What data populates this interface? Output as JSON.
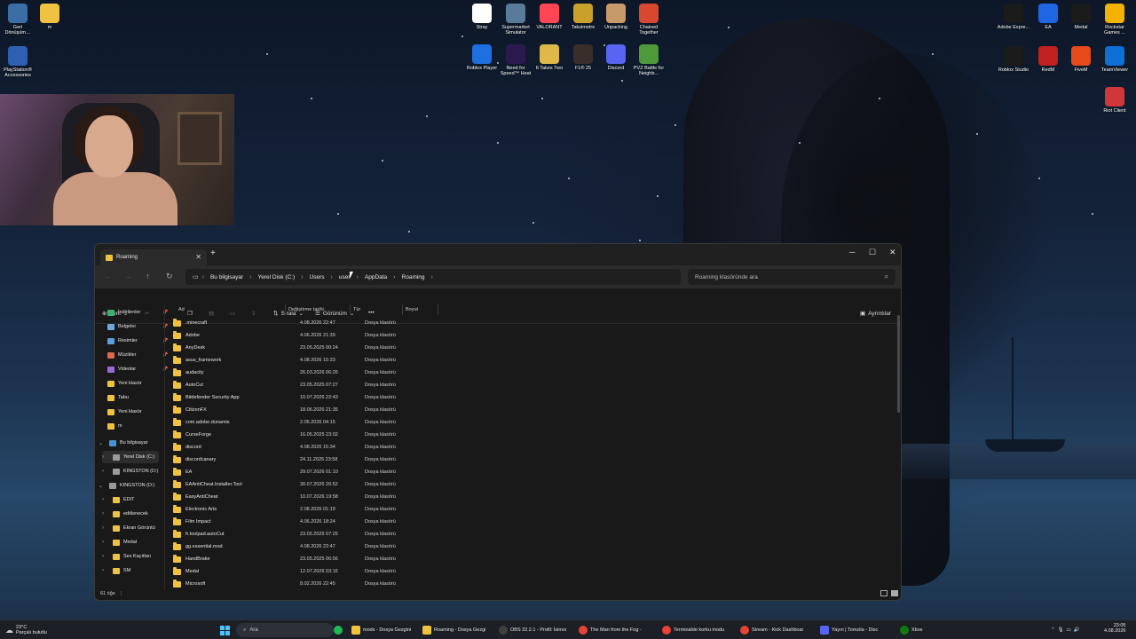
{
  "desktop": {
    "left_icons": [
      {
        "label": "Geri Dönüşüm…",
        "icon": "recycle-bin-icon",
        "color": "#3a6ea5"
      },
      {
        "label": "m",
        "icon": "folder-icon",
        "color": "#f0c242"
      },
      {
        "label": "PlayStation® Accessories",
        "icon": "playstation-icon",
        "color": "#2f5fb3"
      }
    ],
    "center_icons": [
      {
        "label": "Stray",
        "icon": "cat-icon",
        "color": "#ffffff"
      },
      {
        "label": "Supermarket Simulator",
        "icon": "supermarket-icon",
        "color": "#5a7a9a"
      },
      {
        "label": "VALORANT",
        "icon": "valorant-icon",
        "color": "#ff4655"
      },
      {
        "label": "Taksimetre",
        "icon": "taxi-icon",
        "color": "#c9a12a"
      },
      {
        "label": "Unpacking",
        "icon": "box-icon",
        "color": "#c89a6a"
      },
      {
        "label": "Chained Together",
        "icon": "chain-icon",
        "color": "#d8482f"
      },
      {
        "label": "Roblox Player",
        "icon": "roblox-icon",
        "color": "#1e6fe0"
      },
      {
        "label": "Need for Speed™ Heat",
        "icon": "nfs-icon",
        "color": "#2a1a4e"
      },
      {
        "label": "It Takes Two",
        "icon": "it-takes-two-icon",
        "color": "#e0b84a"
      },
      {
        "label": "F1® 25",
        "icon": "f1-icon",
        "color": "#3a2e2a"
      },
      {
        "label": "Discord",
        "icon": "discord-icon",
        "color": "#5865f2"
      },
      {
        "label": "PVZ Battle for Neighb...",
        "icon": "pvz-icon",
        "color": "#4e9a3a"
      }
    ],
    "right_icons": [
      {
        "label": "Adobe Expre...",
        "icon": "adobe-express-icon",
        "color": "#1b1b1b"
      },
      {
        "label": "EA",
        "icon": "ea-icon",
        "color": "#1f66e5"
      },
      {
        "label": "Medal",
        "icon": "medal-icon",
        "color": "#1b1b1b"
      },
      {
        "label": "Rockstar Games ...",
        "icon": "rockstar-icon",
        "color": "#f3b200"
      },
      {
        "label": "Roblox Studio",
        "icon": "roblox-studio-icon",
        "color": "#1b1b1b"
      },
      {
        "label": "RedM",
        "icon": "redm-icon",
        "color": "#c0201f"
      },
      {
        "label": "FiveM",
        "icon": "fivem-icon",
        "color": "#e64a19"
      },
      {
        "label": "TeamViewer",
        "icon": "teamviewer-icon",
        "color": "#0e6fd6"
      },
      {
        "label": "Riot Client",
        "icon": "riot-icon",
        "color": "#d13639"
      }
    ]
  },
  "explorer": {
    "tab_title": "Roaming",
    "breadcrumbs": [
      "Bu bilgisayar",
      "Yerel Disk (C:)",
      "Users",
      "user",
      "AppData",
      "Roaming"
    ],
    "search_placeholder": "Roaming klasöründe ara",
    "toolbar": {
      "new": "Yeni",
      "sort": "Sırala",
      "view": "Görünüm",
      "more": "•••",
      "details": "Ayrıntılar"
    },
    "sidebar": [
      {
        "label": "İndirilenler",
        "icon": "download-icon",
        "color": "#3cb371",
        "pinned": true
      },
      {
        "label": "Belgeler",
        "icon": "document-icon",
        "color": "#6fa8dc",
        "pinned": true
      },
      {
        "label": "Resimler",
        "icon": "pictures-icon",
        "color": "#5aa0e0",
        "pinned": true
      },
      {
        "label": "Müzikler",
        "icon": "music-icon",
        "color": "#e06a50",
        "pinned": true
      },
      {
        "label": "Videolar",
        "icon": "video-icon",
        "color": "#9a6ad8",
        "pinned": true
      },
      {
        "label": "Yeni klasör",
        "icon": "folder-icon",
        "color": "#f0c242",
        "pinned": false
      },
      {
        "label": "Tabu",
        "icon": "folder-icon",
        "color": "#f0c242",
        "pinned": false
      },
      {
        "label": "Yeni klasör",
        "icon": "folder-icon",
        "color": "#f0c242",
        "pinned": false
      },
      {
        "label": "m",
        "icon": "folder-icon",
        "color": "#f0c242",
        "pinned": false
      }
    ],
    "tree": [
      {
        "label": "Bu bilgisayar",
        "icon": "computer-icon",
        "color": "#4a90d9",
        "expanded": true,
        "indent": 0,
        "selected": false
      },
      {
        "label": "Yerel Disk (C:)",
        "icon": "drive-icon",
        "color": "#9a9a9a",
        "expanded": false,
        "indent": 1,
        "selected": true
      },
      {
        "label": "KINGSTON (D:)",
        "icon": "drive-icon",
        "color": "#9a9a9a",
        "expanded": false,
        "indent": 1,
        "selected": false
      },
      {
        "label": "KINGSTON (D:)",
        "icon": "usb-drive-icon",
        "color": "#9a9a9a",
        "expanded": true,
        "indent": 0,
        "selected": false
      },
      {
        "label": "EDIT",
        "icon": "folder-icon",
        "color": "#f0c242",
        "expanded": false,
        "indent": 1,
        "selected": false
      },
      {
        "label": "editlenecek",
        "icon": "folder-icon",
        "color": "#f0c242",
        "expanded": false,
        "indent": 1,
        "selected": false
      },
      {
        "label": "Ekran Görüntü",
        "icon": "folder-icon",
        "color": "#f0c242",
        "expanded": false,
        "indent": 1,
        "selected": false
      },
      {
        "label": "Medal",
        "icon": "folder-icon",
        "color": "#f0c242",
        "expanded": false,
        "indent": 1,
        "selected": false
      },
      {
        "label": "Ses Kayıtları",
        "icon": "folder-icon",
        "color": "#f0c242",
        "expanded": false,
        "indent": 1,
        "selected": false
      },
      {
        "label": "SM",
        "icon": "folder-icon",
        "color": "#f0c242",
        "expanded": false,
        "indent": 1,
        "selected": false
      }
    ],
    "columns": [
      "Ad",
      "Değiştirme tarihi",
      "Tür",
      "Boyut"
    ],
    "rows": [
      {
        "name": ".minecraft",
        "date": "4.08.2026 22:47",
        "type": "Dosya klasörü"
      },
      {
        "name": "Adobe",
        "date": "4.06.2026 21:39",
        "type": "Dosya klasörü"
      },
      {
        "name": "AnyDesk",
        "date": "23.05.2025 00:24",
        "type": "Dosya klasörü"
      },
      {
        "name": "asus_framework",
        "date": "4.08.2026 15:33",
        "type": "Dosya klasörü"
      },
      {
        "name": "audacity",
        "date": "26.03.2026 06:26",
        "type": "Dosya klasörü"
      },
      {
        "name": "AutoCut",
        "date": "23.05.2025 07:27",
        "type": "Dosya klasörü"
      },
      {
        "name": "Bitdefender Security App",
        "date": "10.07.2026 22:43",
        "type": "Dosya klasörü"
      },
      {
        "name": "CitizenFX",
        "date": "18.06.2026 21:35",
        "type": "Dosya klasörü"
      },
      {
        "name": "com.adobe.dunamis",
        "date": "2.05.2026 04:15",
        "type": "Dosya klasörü"
      },
      {
        "name": "CurseForge",
        "date": "16.05.2025 23:02",
        "type": "Dosya klasörü"
      },
      {
        "name": "discord",
        "date": "4.08.2026 15:34",
        "type": "Dosya klasörü"
      },
      {
        "name": "discordcanary",
        "date": "24.11.2025 23:58",
        "type": "Dosya klasörü"
      },
      {
        "name": "EA",
        "date": "29.07.2026 01:10",
        "type": "Dosya klasörü"
      },
      {
        "name": "EAAntiCheat.Installer.Tool",
        "date": "30.07.2026 20:52",
        "type": "Dosya klasörü"
      },
      {
        "name": "EasyAntiCheat",
        "date": "10.07.2026 19:58",
        "type": "Dosya klasörü"
      },
      {
        "name": "Electronic Arts",
        "date": "2.08.2026 01:19",
        "type": "Dosya klasörü"
      },
      {
        "name": "Film Impact",
        "date": "4.06.2026 18:24",
        "type": "Dosya klasörü"
      },
      {
        "name": "fr.toolpad.autoCut",
        "date": "23.05.2025 07:25",
        "type": "Dosya klasörü"
      },
      {
        "name": "gg.essential.mod",
        "date": "4.08.2026 22:47",
        "type": "Dosya klasörü"
      },
      {
        "name": "HandBrake",
        "date": "23.05.2025 06:56",
        "type": "Dosya klasörü"
      },
      {
        "name": "Medal",
        "date": "12.07.2026 03:16",
        "type": "Dosya klasörü"
      },
      {
        "name": "Microsoft",
        "date": "8.02.2026 22:45",
        "type": "Dosya klasörü"
      }
    ],
    "status": "61 öğe"
  },
  "taskbar": {
    "weather_temp": "23°C",
    "weather_desc": "Parçalı bulutlu",
    "search_label": "Ara",
    "items": [
      {
        "label": "",
        "icon": "spotify-icon",
        "color": "#1db954"
      },
      {
        "label": "mods - Dosya Gezgini",
        "icon": "folder-icon",
        "color": "#f0c242"
      },
      {
        "label": "Roaming - Dosya Gezgi",
        "icon": "folder-icon",
        "color": "#f0c242"
      },
      {
        "label": "OBS 32.2.1 - Profil: İsimsi",
        "icon": "obs-icon",
        "color": "#404040"
      },
      {
        "label": "The Man from the Fog -",
        "icon": "chrome-icon",
        "color": "#e84335"
      },
      {
        "label": "Terminalde korku modu",
        "icon": "chrome-icon",
        "color": "#e84335"
      },
      {
        "label": "Stream - Kick Dashboar",
        "icon": "chrome-icon",
        "color": "#e84335"
      },
      {
        "label": "Yayın | Tomzila - Disc",
        "icon": "discord-icon",
        "color": "#5865f2"
      },
      {
        "label": "Xbox",
        "icon": "xbox-icon",
        "color": "#107c10"
      }
    ],
    "time": "23:05",
    "date": "4.08.2026"
  }
}
